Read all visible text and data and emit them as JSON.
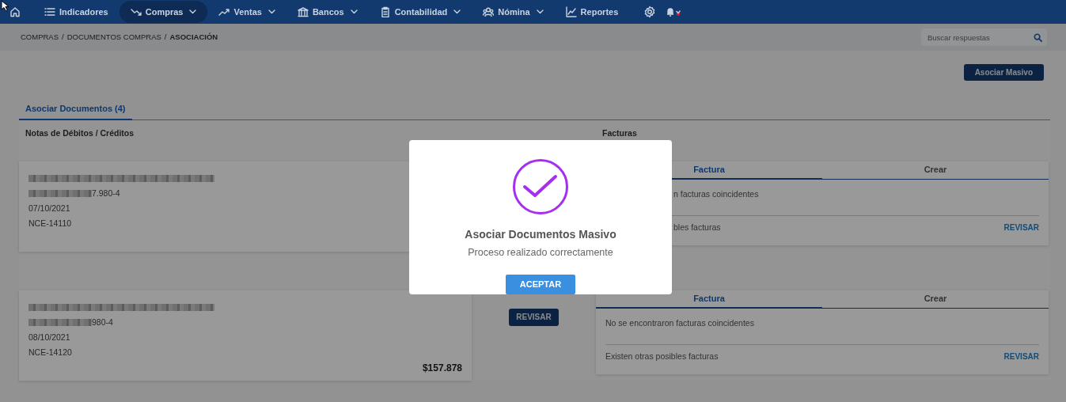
{
  "navbar": {
    "items": [
      {
        "label": "Indicadores",
        "dropdown": false,
        "selected": false
      },
      {
        "label": "Compras",
        "dropdown": true,
        "selected": true
      },
      {
        "label": "Ventas",
        "dropdown": true,
        "selected": false
      },
      {
        "label": "Bancos",
        "dropdown": true,
        "selected": false
      },
      {
        "label": "Contabilidad",
        "dropdown": true,
        "selected": false
      },
      {
        "label": "Nómina",
        "dropdown": true,
        "selected": false
      },
      {
        "label": "Reportes",
        "dropdown": false,
        "selected": false
      }
    ],
    "notification": true
  },
  "breadcrumb": [
    {
      "kind": "link",
      "label": "COMPRAS",
      "current": false
    },
    {
      "kind": "separator",
      "label": "/"
    },
    {
      "kind": "link",
      "label": "DOCUMENTOS COMPRAS",
      "current": false
    },
    {
      "kind": "separator",
      "label": "/"
    },
    {
      "kind": "link",
      "label": "ASOCIACIÓN",
      "current": true
    }
  ],
  "search": {
    "placeholder": "Buscar respuestas"
  },
  "bulk_button": "Asociar Masivo",
  "tabs": [
    {
      "label": "Asociar Documentos (4)",
      "selected": true
    }
  ],
  "notes_heading": "Notas de Débitos / Créditos",
  "invoices_heading": "Facturas",
  "pairs": [
    {
      "note": {
        "name_redacted": true,
        "tax_id": "7.980-4",
        "date": "07/10/2021",
        "number": "NCE-14110"
      },
      "invoice": {
        "tabs": [
          {
            "label": "Factura",
            "selected": true
          },
          {
            "label": "Crear",
            "selected": false
          }
        ],
        "clipped": true,
        "message": "n facturas coincidentes",
        "other": "bles facturas",
        "review_link": "REVISAR"
      }
    },
    {
      "note": {
        "name_redacted": true,
        "tax_id": "980-4",
        "date": "08/10/2021",
        "number": "NCE-14120",
        "amount": "$157.878"
      },
      "review_button": "REVISAR",
      "invoice": {
        "tabs": [
          {
            "label": "Factura",
            "selected": true
          },
          {
            "label": "Crear",
            "selected": false
          }
        ],
        "clipped": false,
        "message": "No se encontraron facturas coincidentes",
        "other": "Existen otras posibles facturas",
        "review_link": "REVISAR"
      }
    }
  ],
  "modal": {
    "title": "Asociar Documentos Masivo",
    "message": "Proceso realizado correctamente",
    "button": "ACEPTAR"
  }
}
